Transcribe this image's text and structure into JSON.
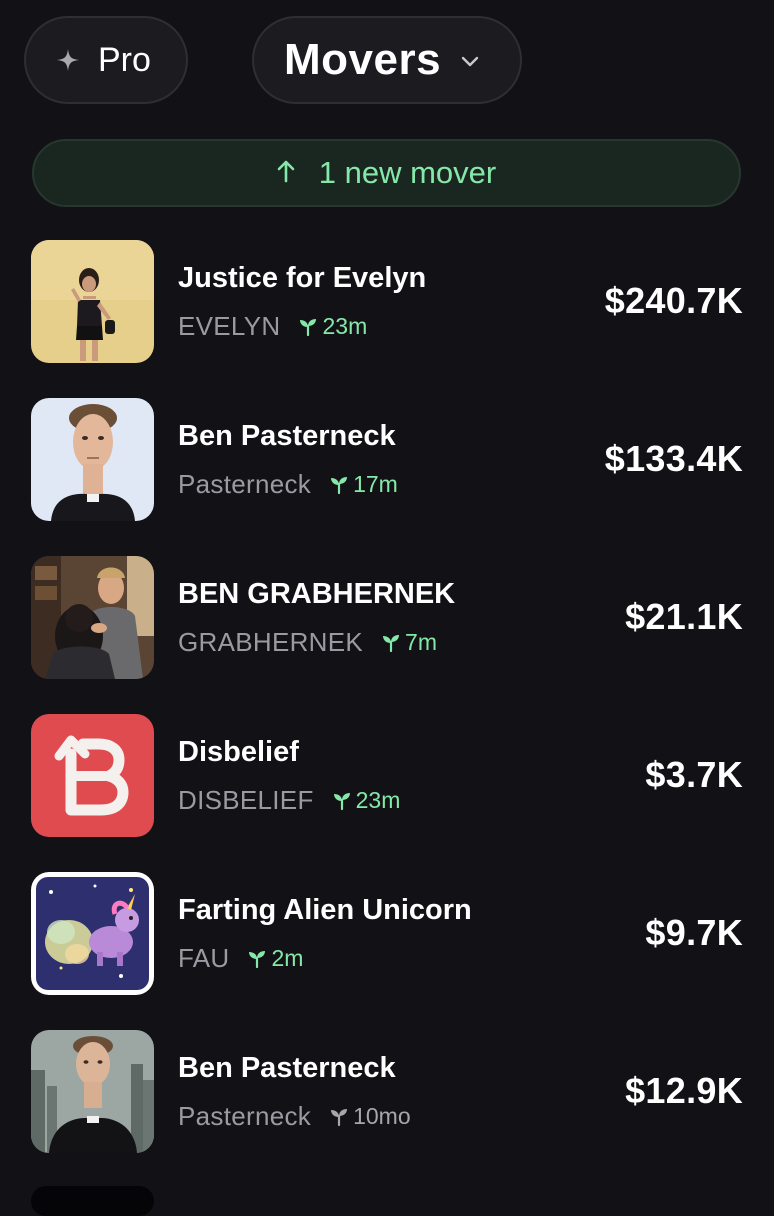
{
  "header": {
    "pro_label": "Pro",
    "feed_label": "Movers"
  },
  "banner": {
    "text": "1 new mover"
  },
  "colors": {
    "background": "#111116",
    "accent_green": "#86e8a8",
    "muted_text": "#9a9aa2"
  },
  "movers": [
    {
      "name": "Justice for Evelyn",
      "ticker": "EVELYN",
      "age": "23m",
      "value": "$240.7K",
      "fresh": true
    },
    {
      "name": "Ben Pasterneck",
      "ticker": "Pasterneck",
      "age": "17m",
      "value": "$133.4K",
      "fresh": true
    },
    {
      "name": "BEN GRABHERNEK",
      "ticker": "GRABHERNEK",
      "age": "7m",
      "value": "$21.1K",
      "fresh": true
    },
    {
      "name": "Disbelief",
      "ticker": "DISBELIEF",
      "age": "23m",
      "value": "$3.7K",
      "fresh": true
    },
    {
      "name": "Farting Alien Unicorn",
      "ticker": "FAU",
      "age": "2m",
      "value": "$9.7K",
      "fresh": true
    },
    {
      "name": "Ben Pasterneck",
      "ticker": "Pasterneck",
      "age": "10mo",
      "value": "$12.9K",
      "fresh": false
    }
  ]
}
